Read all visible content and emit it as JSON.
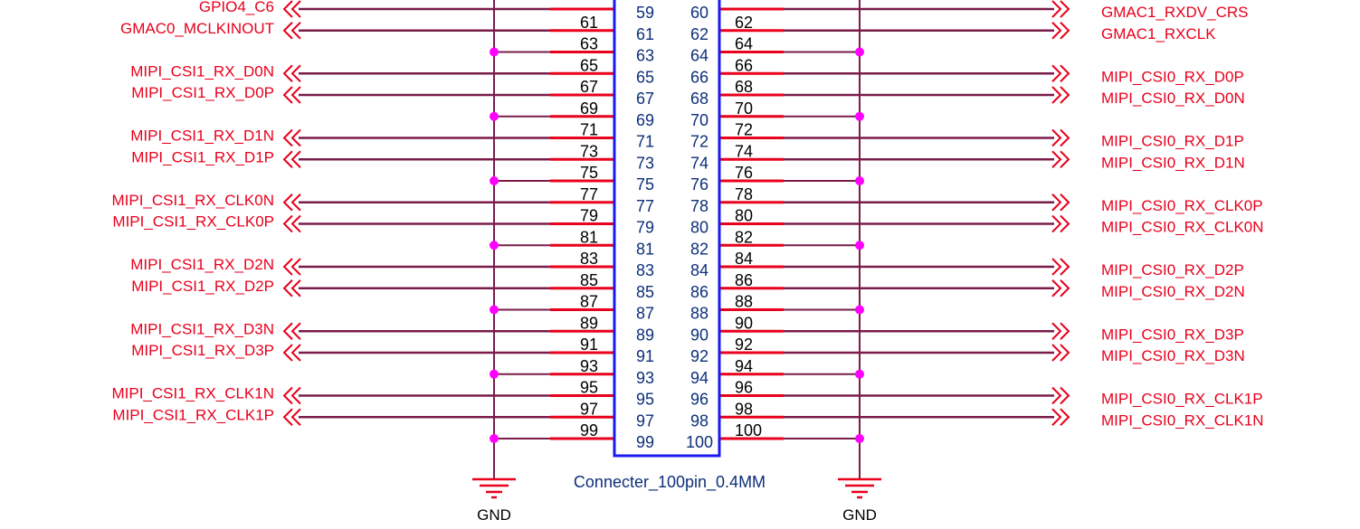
{
  "connector": {
    "part_name": "Connecter_100pin_0.4MM",
    "body_color": "#1a1aee"
  },
  "colors": {
    "wire": "#7a1c4a",
    "pin_stub": "#e8001c",
    "net_label": "#e8001c",
    "junction": "#ff00ff",
    "pin_number": "#0d2f7a",
    "ground": "#e8001c"
  },
  "ground": {
    "label": "GND"
  },
  "rows": [
    {
      "left_pin": "59",
      "right_pin": "60",
      "left_wire": "",
      "right_wire": "",
      "left_net": "GPIO4_C6",
      "right_net": "GMAC1_RXDV_CRS",
      "left_gnd": false,
      "right_gnd": false
    },
    {
      "left_pin": "61",
      "right_pin": "62",
      "left_wire": "61",
      "right_wire": "62",
      "left_net": "GMAC0_MCLKINOUT",
      "right_net": "GMAC1_RXCLK",
      "left_gnd": false,
      "right_gnd": false
    },
    {
      "left_pin": "63",
      "right_pin": "64",
      "left_wire": "63",
      "right_wire": "64",
      "left_net": "",
      "right_net": "",
      "left_gnd": true,
      "right_gnd": true
    },
    {
      "left_pin": "65",
      "right_pin": "66",
      "left_wire": "65",
      "right_wire": "66",
      "left_net": "MIPI_CSI1_RX_D0N",
      "right_net": "MIPI_CSI0_RX_D0P",
      "left_gnd": false,
      "right_gnd": false
    },
    {
      "left_pin": "67",
      "right_pin": "68",
      "left_wire": "67",
      "right_wire": "68",
      "left_net": "MIPI_CSI1_RX_D0P",
      "right_net": "MIPI_CSI0_RX_D0N",
      "left_gnd": false,
      "right_gnd": false
    },
    {
      "left_pin": "69",
      "right_pin": "70",
      "left_wire": "69",
      "right_wire": "70",
      "left_net": "",
      "right_net": "",
      "left_gnd": true,
      "right_gnd": true
    },
    {
      "left_pin": "71",
      "right_pin": "72",
      "left_wire": "71",
      "right_wire": "72",
      "left_net": "MIPI_CSI1_RX_D1N",
      "right_net": "MIPI_CSI0_RX_D1P",
      "left_gnd": false,
      "right_gnd": false
    },
    {
      "left_pin": "73",
      "right_pin": "74",
      "left_wire": "73",
      "right_wire": "74",
      "left_net": "MIPI_CSI1_RX_D1P",
      "right_net": "MIPI_CSI0_RX_D1N",
      "left_gnd": false,
      "right_gnd": false
    },
    {
      "left_pin": "75",
      "right_pin": "76",
      "left_wire": "75",
      "right_wire": "76",
      "left_net": "",
      "right_net": "",
      "left_gnd": true,
      "right_gnd": true
    },
    {
      "left_pin": "77",
      "right_pin": "78",
      "left_wire": "77",
      "right_wire": "78",
      "left_net": "MIPI_CSI1_RX_CLK0N",
      "right_net": "MIPI_CSI0_RX_CLK0P",
      "left_gnd": false,
      "right_gnd": false
    },
    {
      "left_pin": "79",
      "right_pin": "80",
      "left_wire": "79",
      "right_wire": "80",
      "left_net": "MIPI_CSI1_RX_CLK0P",
      "right_net": "MIPI_CSI0_RX_CLK0N",
      "left_gnd": false,
      "right_gnd": false
    },
    {
      "left_pin": "81",
      "right_pin": "82",
      "left_wire": "81",
      "right_wire": "82",
      "left_net": "",
      "right_net": "",
      "left_gnd": true,
      "right_gnd": true
    },
    {
      "left_pin": "83",
      "right_pin": "84",
      "left_wire": "83",
      "right_wire": "84",
      "left_net": "MIPI_CSI1_RX_D2N",
      "right_net": "MIPI_CSI0_RX_D2P",
      "left_gnd": false,
      "right_gnd": false
    },
    {
      "left_pin": "85",
      "right_pin": "86",
      "left_wire": "85",
      "right_wire": "86",
      "left_net": "MIPI_CSI1_RX_D2P",
      "right_net": "MIPI_CSI0_RX_D2N",
      "left_gnd": false,
      "right_gnd": false
    },
    {
      "left_pin": "87",
      "right_pin": "88",
      "left_wire": "87",
      "right_wire": "88",
      "left_net": "",
      "right_net": "",
      "left_gnd": true,
      "right_gnd": true
    },
    {
      "left_pin": "89",
      "right_pin": "90",
      "left_wire": "89",
      "right_wire": "90",
      "left_net": "MIPI_CSI1_RX_D3N",
      "right_net": "MIPI_CSI0_RX_D3P",
      "left_gnd": false,
      "right_gnd": false
    },
    {
      "left_pin": "91",
      "right_pin": "92",
      "left_wire": "91",
      "right_wire": "92",
      "left_net": "MIPI_CSI1_RX_D3P",
      "right_net": "MIPI_CSI0_RX_D3N",
      "left_gnd": false,
      "right_gnd": false
    },
    {
      "left_pin": "93",
      "right_pin": "94",
      "left_wire": "93",
      "right_wire": "94",
      "left_net": "",
      "right_net": "",
      "left_gnd": true,
      "right_gnd": true
    },
    {
      "left_pin": "95",
      "right_pin": "96",
      "left_wire": "95",
      "right_wire": "96",
      "left_net": "MIPI_CSI1_RX_CLK1N",
      "right_net": "MIPI_CSI0_RX_CLK1P",
      "left_gnd": false,
      "right_gnd": false
    },
    {
      "left_pin": "97",
      "right_pin": "98",
      "left_wire": "97",
      "right_wire": "98",
      "left_net": "MIPI_CSI1_RX_CLK1P",
      "right_net": "MIPI_CSI0_RX_CLK1N",
      "left_gnd": false,
      "right_gnd": false
    },
    {
      "left_pin": "99",
      "right_pin": "100",
      "left_wire": "99",
      "right_wire": "100",
      "left_net": "",
      "right_net": "",
      "left_gnd": true,
      "right_gnd": true
    }
  ]
}
